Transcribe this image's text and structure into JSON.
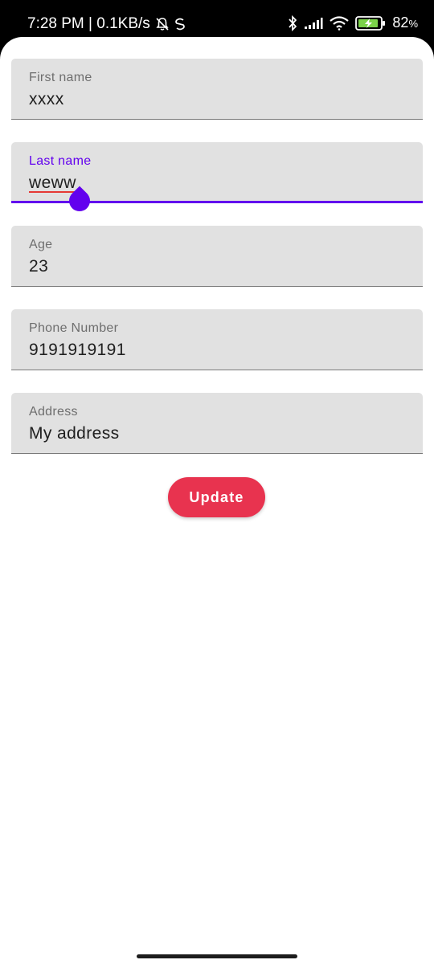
{
  "status_bar": {
    "time_and_speed": "7:28 PM | 0.1KB/s",
    "battery_percent": "82",
    "battery_unit": "%",
    "icons": [
      "alarm-off-icon",
      "sync-icon",
      "bluetooth-icon",
      "signal-icon",
      "wifi-icon",
      "battery-charging-icon"
    ]
  },
  "form": {
    "first_name": {
      "label": "First name",
      "value": "xxxx"
    },
    "last_name": {
      "label": "Last name",
      "value": "weww"
    },
    "age": {
      "label": "Age",
      "value": "23"
    },
    "phone": {
      "label": "Phone Number",
      "value": "9191919191"
    },
    "address": {
      "label": "Address",
      "value": "My address"
    }
  },
  "update_button": {
    "label": "Update"
  },
  "colors": {
    "accent": "#6200ee",
    "button": "#e8334f",
    "field_bg": "#e1e1e1",
    "spell_underline": "#e53935"
  }
}
